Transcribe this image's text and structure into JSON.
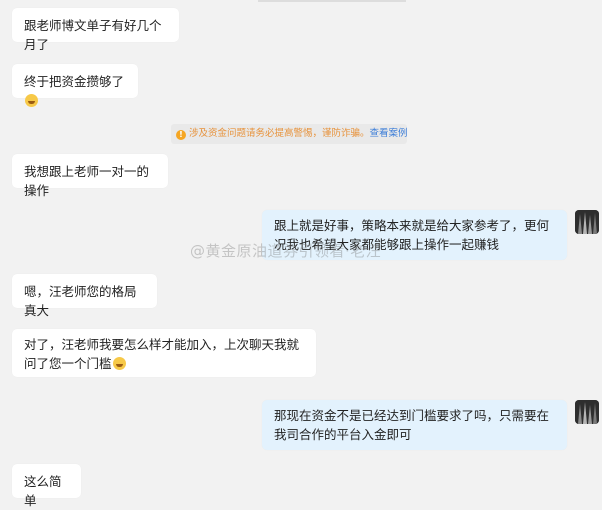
{
  "messages": {
    "m1": "跟老师博文单子有好几个月了",
    "m2": "终于把资金攒够了",
    "m3": "我想跟上老师一对一的操作",
    "m4": "跟上就是好事，策略本来就是给大家参考了，更何况我也希望大家都能够跟上操作一起赚钱",
    "m5": "嗯，汪老师您的格局真大",
    "m6": "对了，汪老师我要怎么样才能加入，上次聊天我就问了您一个门槛",
    "m7": "那现在资金不是已经达到门槛要求了吗，只需要在我司合作的平台入金即可",
    "m8": "这么简单"
  },
  "notice": {
    "text": "涉及资金问题请务必提高警惕，谨防诈骗。",
    "link": "查看案例"
  },
  "watermark": "@黄金原油道券引领看·老汪",
  "icons": {
    "emoji_smile": "grin-emoji",
    "emoji_laugh": "laughing-emoji",
    "warning": "warning-icon"
  },
  "colors": {
    "background": "#f2f2f2",
    "incoming_bubble": "#ffffff",
    "outgoing_bubble": "#e3f2fd",
    "notice_text": "#e7923b",
    "notice_link": "#3b7dd8"
  }
}
